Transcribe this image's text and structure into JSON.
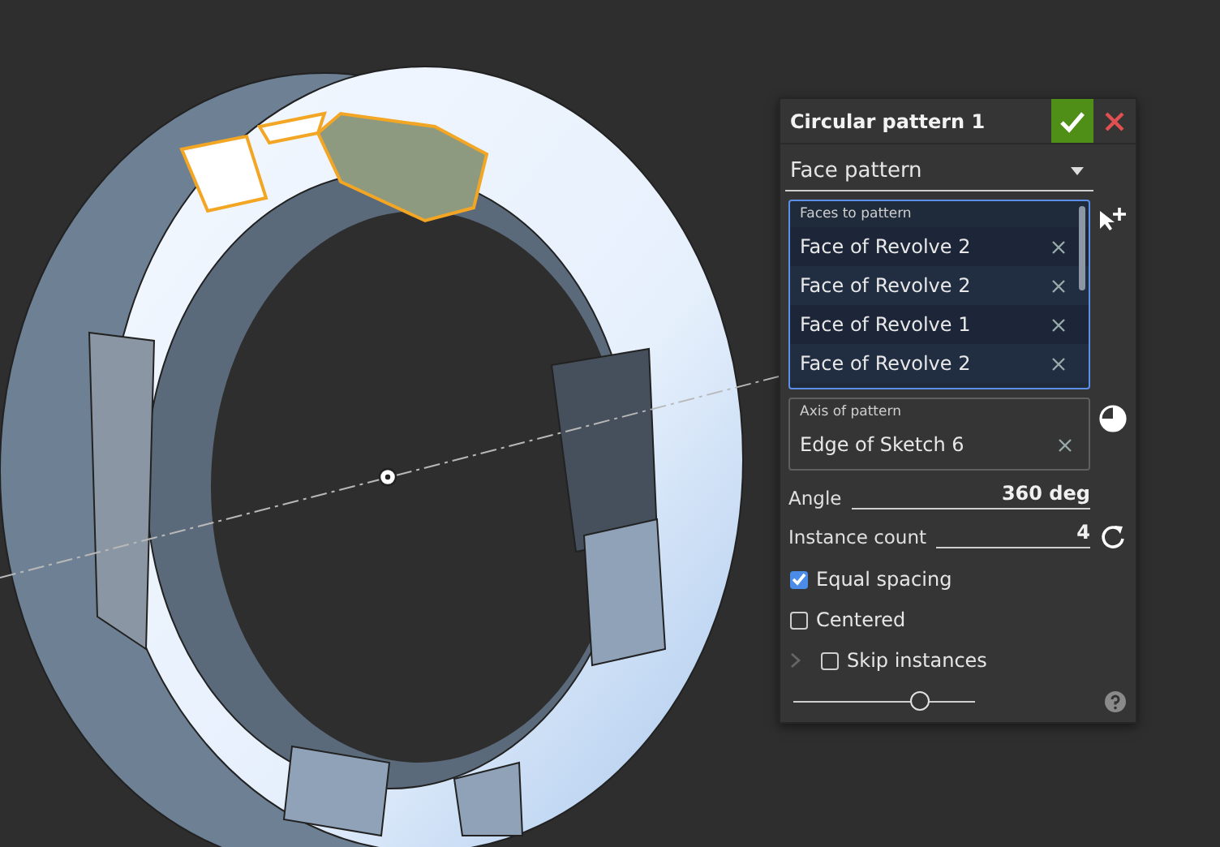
{
  "panel": {
    "title": "Circular pattern 1",
    "pattern_type": "Face pattern",
    "faces": {
      "label": "Faces to pattern",
      "items": [
        "Face of Revolve 2",
        "Face of Revolve 2",
        "Face of Revolve 1",
        "Face of Revolve 2"
      ]
    },
    "axis": {
      "label": "Axis of pattern",
      "items": [
        "Edge of Sketch 6"
      ]
    },
    "angle": {
      "label": "Angle",
      "value": "360 deg"
    },
    "instance_count": {
      "label": "Instance count",
      "value": "4"
    },
    "options": [
      {
        "label": "Equal spacing",
        "checked": true
      },
      {
        "label": "Centered",
        "checked": false
      }
    ],
    "skip_instances": {
      "label": "Skip instances",
      "checked": false,
      "expanded": false
    },
    "slider": {
      "level": 0.7
    }
  }
}
